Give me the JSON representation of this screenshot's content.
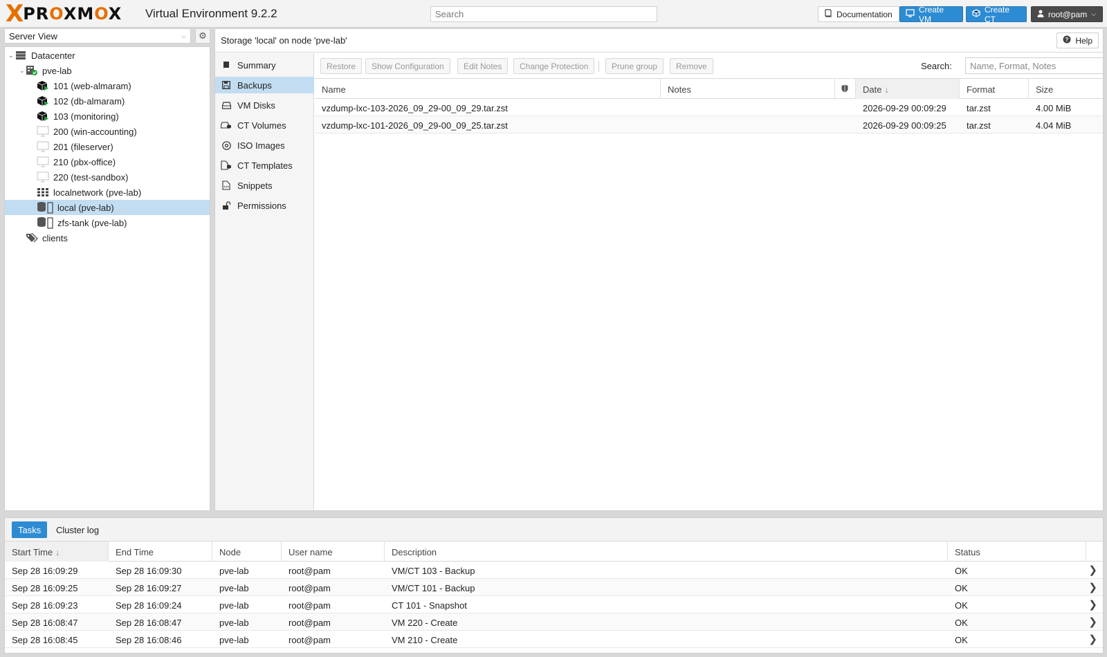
{
  "header": {
    "logo_x": "X",
    "logo_text_a": "PR",
    "logo_text_o1": "O",
    "logo_text_b": "XM",
    "logo_text_o2": "O",
    "logo_text_c": "X",
    "version": "Virtual Environment 9.2.2",
    "search_placeholder": "Search",
    "documentation_label": "Documentation",
    "create_vm_label": "Create VM",
    "create_ct_label": "Create CT",
    "user_label": "root@pam"
  },
  "sidebar": {
    "view": "Server View",
    "tree": [
      {
        "label": "Datacenter",
        "icon": "server-rack-icon"
      },
      {
        "label": "pve-lab",
        "icon": "node-online-icon"
      },
      {
        "label": "101 (web-almaram)",
        "icon": "container-running-icon"
      },
      {
        "label": "102 (db-almaram)",
        "icon": "container-running-icon"
      },
      {
        "label": "103 (monitoring)",
        "icon": "container-running-icon"
      },
      {
        "label": "200 (win-accounting)",
        "icon": "vm-stopped-icon"
      },
      {
        "label": "201 (fileserver)",
        "icon": "vm-stopped-icon"
      },
      {
        "label": "210 (pbx-office)",
        "icon": "vm-stopped-icon"
      },
      {
        "label": "220 (test-sandbox)",
        "icon": "vm-stopped-icon"
      },
      {
        "label": "localnetwork (pve-lab)",
        "icon": "network-grid-icon"
      },
      {
        "label": "local (pve-lab)",
        "icon": "storage-icon"
      },
      {
        "label": "zfs-tank (pve-lab)",
        "icon": "storage-icon"
      },
      {
        "label": "clients",
        "icon": "tags-icon"
      }
    ]
  },
  "content": {
    "title": "Storage 'local' on node 'pve-lab'",
    "help_label": "Help",
    "nav": [
      {
        "label": "Summary",
        "icon": "book-icon"
      },
      {
        "label": "Backups",
        "icon": "floppy-icon"
      },
      {
        "label": "VM Disks",
        "icon": "hdd-icon"
      },
      {
        "label": "CT Volumes",
        "icon": "ct-volume-icon"
      },
      {
        "label": "ISO Images",
        "icon": "disc-icon"
      },
      {
        "label": "CT Templates",
        "icon": "ct-template-icon"
      },
      {
        "label": "Snippets",
        "icon": "file-code-icon"
      },
      {
        "label": "Permissions",
        "icon": "unlock-icon"
      }
    ],
    "toolbar": {
      "restore": "Restore",
      "show_config": "Show Configuration",
      "edit_notes": "Edit Notes",
      "change_protection": "Change Protection",
      "prune_group": "Prune group",
      "remove": "Remove",
      "search_label": "Search:",
      "search_placeholder": "Name, Format, Notes"
    },
    "columns": {
      "name": "Name",
      "notes": "Notes",
      "date": "Date",
      "format": "Format",
      "size": "Size"
    },
    "rows": [
      {
        "name": "vzdump-lxc-103-2026_09_29-00_09_29.tar.zst",
        "notes": "",
        "date": "2026-09-29 00:09:29",
        "format": "tar.zst",
        "size": "4.00 MiB"
      },
      {
        "name": "vzdump-lxc-101-2026_09_29-00_09_25.tar.zst",
        "notes": "",
        "date": "2026-09-29 00:09:25",
        "format": "tar.zst",
        "size": "4.04 MiB"
      }
    ]
  },
  "tasks": {
    "tab_tasks": "Tasks",
    "tab_cluster_log": "Cluster log",
    "columns": {
      "start": "Start Time",
      "end": "End Time",
      "node": "Node",
      "user": "User name",
      "desc": "Description",
      "status": "Status"
    },
    "rows": [
      {
        "start": "Sep 28 16:09:29",
        "end": "Sep 28 16:09:30",
        "node": "pve-lab",
        "user": "root@pam",
        "desc": "VM/CT 103 - Backup",
        "status": "OK"
      },
      {
        "start": "Sep 28 16:09:25",
        "end": "Sep 28 16:09:27",
        "node": "pve-lab",
        "user": "root@pam",
        "desc": "VM/CT 101 - Backup",
        "status": "OK"
      },
      {
        "start": "Sep 28 16:09:23",
        "end": "Sep 28 16:09:24",
        "node": "pve-lab",
        "user": "root@pam",
        "desc": "CT 101 - Snapshot",
        "status": "OK"
      },
      {
        "start": "Sep 28 16:08:47",
        "end": "Sep 28 16:08:47",
        "node": "pve-lab",
        "user": "root@pam",
        "desc": "VM 220 - Create",
        "status": "OK"
      },
      {
        "start": "Sep 28 16:08:45",
        "end": "Sep 28 16:08:46",
        "node": "pve-lab",
        "user": "root@pam",
        "desc": "VM 210 - Create",
        "status": "OK"
      }
    ]
  },
  "colors": {
    "accent": "#2d8bd3",
    "brand_orange": "#e57000",
    "selection": "#c2ddf2",
    "status_running": "#21a341"
  }
}
